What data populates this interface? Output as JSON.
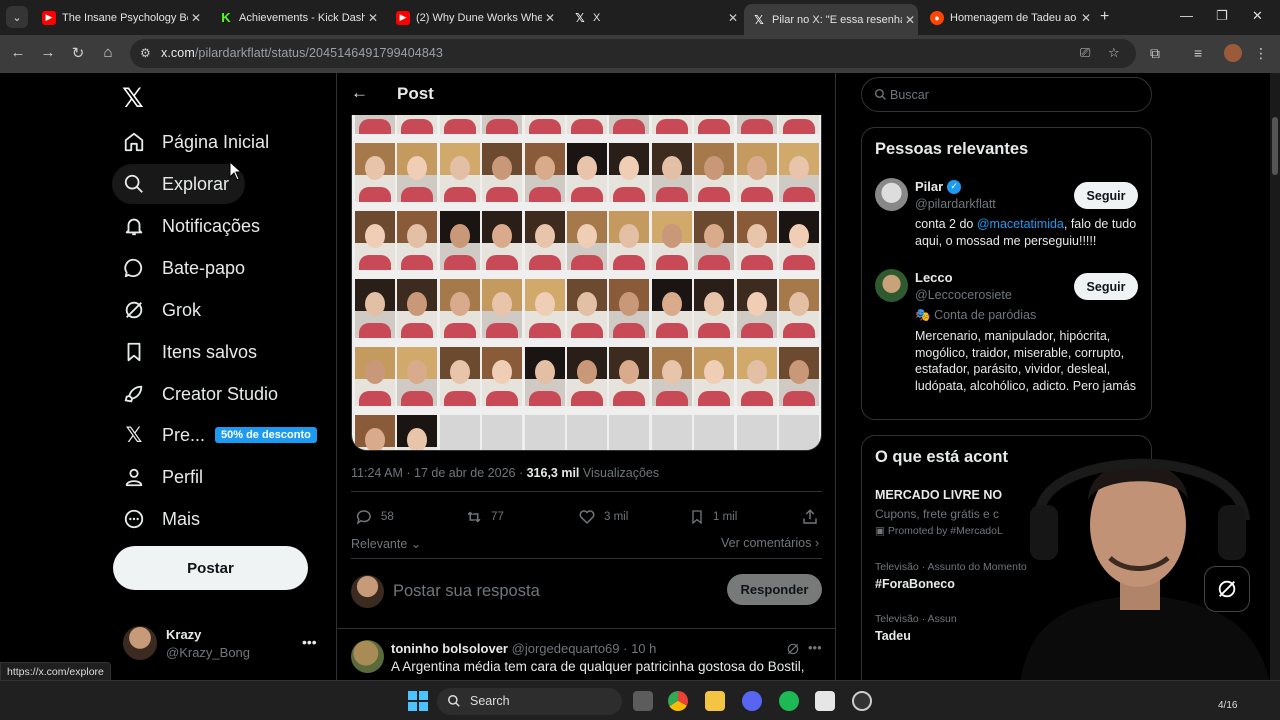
{
  "browser": {
    "tabs": [
      {
        "title": "The Insane Psychology Beh",
        "icon": "youtube-icon"
      },
      {
        "title": "Achievements - Kick Dashb",
        "icon": "kick-icon"
      },
      {
        "title": "(2) Why Dune Works When",
        "icon": "youtube-icon"
      },
      {
        "title": "X",
        "icon": "x-icon"
      },
      {
        "title": "Pilar no X: \"E essa resenha",
        "icon": "x-icon"
      },
      {
        "title": "Homenagem de Tadeu ao",
        "icon": "reddit-icon"
      }
    ],
    "url_host": "x.com",
    "url_path": "/pilardarkflatt/status/2045146491799404843",
    "status_url": "https://x.com/explore"
  },
  "sidebar": {
    "items": [
      {
        "label": "Página Inicial",
        "icon": "home-icon"
      },
      {
        "label": "Explorar",
        "icon": "search-icon"
      },
      {
        "label": "Notificações",
        "icon": "bell-icon"
      },
      {
        "label": "Bate-papo",
        "icon": "chat-icon"
      },
      {
        "label": "Grok",
        "icon": "grok-icon"
      },
      {
        "label": "Itens salvos",
        "icon": "bookmark-icon"
      },
      {
        "label": "Creator Studio",
        "icon": "rocket-icon"
      },
      {
        "label": "Pre...",
        "icon": "x-icon"
      },
      {
        "label": "Perfil",
        "icon": "person-icon"
      },
      {
        "label": "Mais",
        "icon": "more-circle-icon"
      }
    ],
    "promo_badge": "50% de desconto",
    "post_button": "Postar",
    "account": {
      "name": "Krazy",
      "handle": "@Krazy_Bong"
    }
  },
  "post": {
    "header_title": "Post",
    "time": "11:24 AM · 17 de abr de 2026 · ",
    "views_count": "316,3 mil",
    "views_label": " Visualizações",
    "actions": {
      "replies": "58",
      "reposts": "77",
      "likes": "3 mil",
      "bookmarks": "1 mil"
    },
    "sort_label": "Relevante",
    "see_comments": "Ver comentários",
    "reply_placeholder": "Postar sua resposta",
    "reply_button": "Responder"
  },
  "comment": {
    "name": "toninho bolsolover",
    "handle": "@jorgedequarto69 · 10 h",
    "text": "A Argentina média tem cara de qualquer patricinha gostosa do Bostil,"
  },
  "right": {
    "search_placeholder": "Buscar",
    "relevant_title": "Pessoas relevantes",
    "people": [
      {
        "name": "Pilar",
        "handle": "@pilardarkflatt",
        "bio_pre": "conta 2 do ",
        "bio_mention": "@macetatimida",
        "bio_post": ", falo de tudo aqui, o mossad me perseguiu!!!!!",
        "follow": "Seguir",
        "verified": true
      },
      {
        "name": "Lecco",
        "handle": "@Leccocerosiete",
        "parody": "Conta de paródias",
        "bio": "Mercenario, manipulador, hipócrita, mogólico, traidor, miserable, corrupto, estafador, parásito, vividor, desleal, ludópata, alcohólico, adicto. Pero jamás",
        "follow": "Seguir"
      }
    ],
    "trends_title": "O que está acont",
    "trends": [
      {
        "name": "MERCADO LIVRE NO",
        "sub": "Cupons, frete grátis e c",
        "promo": "Promoted by #MercadoL"
      },
      {
        "cat": "Televisão · Assunto do Momento",
        "name": "#ForaBoneco"
      },
      {
        "cat": "Televisão · Assun",
        "name": "Tadeu"
      }
    ]
  },
  "taskbar": {
    "search_label": "Search",
    "page_indicator": "4/16"
  },
  "colors": {
    "accent": "#1d9bf0",
    "background": "#000000",
    "border": "#2f3336",
    "muted": "#71767b"
  }
}
